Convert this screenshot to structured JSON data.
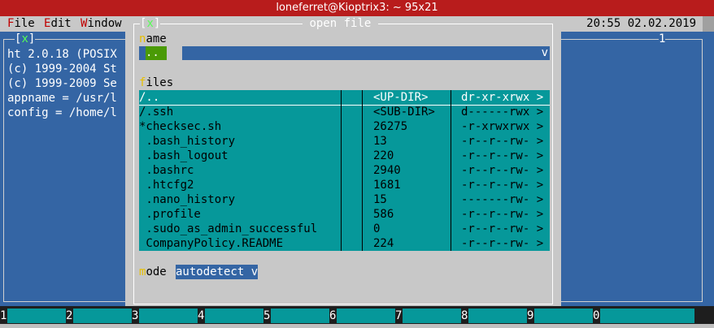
{
  "window": {
    "title": "loneferret@Kioptrix3: ~ 95x21"
  },
  "menubar": {
    "items": [
      {
        "hot": "F",
        "rest": "ile"
      },
      {
        "hot": "E",
        "rest": "dit"
      },
      {
        "hot": "W",
        "rest": "indow"
      }
    ],
    "clock": "20:55 02.02.2019"
  },
  "main_window": {
    "close": "[x]",
    "number": "1",
    "lines": [
      "ht 2.0.18 (POSIX",
      "(c) 1999-2004 St",
      "(c) 1999-2009 Se",
      "appname = /usr/l",
      "config = /home/l"
    ]
  },
  "dialog": {
    "close": "[x]",
    "title": "open file",
    "name_label": {
      "hot": "n",
      "rest": "ame"
    },
    "name_value": "..",
    "name_dropdown": "v",
    "files_label": {
      "hot": "f",
      "rest": "iles"
    },
    "mode_label": {
      "hot": "m",
      "rest": "ode"
    },
    "mode_value": "autodetect v",
    "files": [
      {
        "name": "/..",
        "size": "<UP-DIR>",
        "perm": "dr-xr-xrwx >"
      },
      {
        "name": "/.ssh",
        "size": "<SUB-DIR>",
        "perm": "d------rwx >"
      },
      {
        "name": "*checksec.sh",
        "size": "26275",
        "perm": "-r-xrwxrwx >"
      },
      {
        "name": " .bash_history",
        "size": "13",
        "perm": "-r--r--rw- >"
      },
      {
        "name": " .bash_logout",
        "size": "220",
        "perm": "-r--r--rw- >"
      },
      {
        "name": " .bashrc",
        "size": "2940",
        "perm": "-r--r--rw- >"
      },
      {
        "name": " .htcfg2",
        "size": "1681",
        "perm": "-r--r--rw- >"
      },
      {
        "name": " .nano_history",
        "size": "15",
        "perm": "-------rw- >"
      },
      {
        "name": " .profile",
        "size": "586",
        "perm": "-r--r--rw- >"
      },
      {
        "name": " .sudo_as_admin_successful",
        "size": "0",
        "perm": "-r--r--rw- >"
      },
      {
        "name": " CompanyPolicy.README",
        "size": "224",
        "perm": "-r--r--rw- >"
      }
    ]
  },
  "function_keys": [
    "1",
    "2",
    "3",
    "4",
    "5",
    "6",
    "7",
    "8",
    "9",
    "0"
  ],
  "colors": {
    "titlebar": "#b81c1c",
    "window_bg": "#3465a4",
    "dialog_bg": "#c8c8c8",
    "list_bg": "#06989a",
    "hotkey": "#e8c000",
    "menu_hotkey": "#c00000",
    "close_x": "#55ff55"
  }
}
